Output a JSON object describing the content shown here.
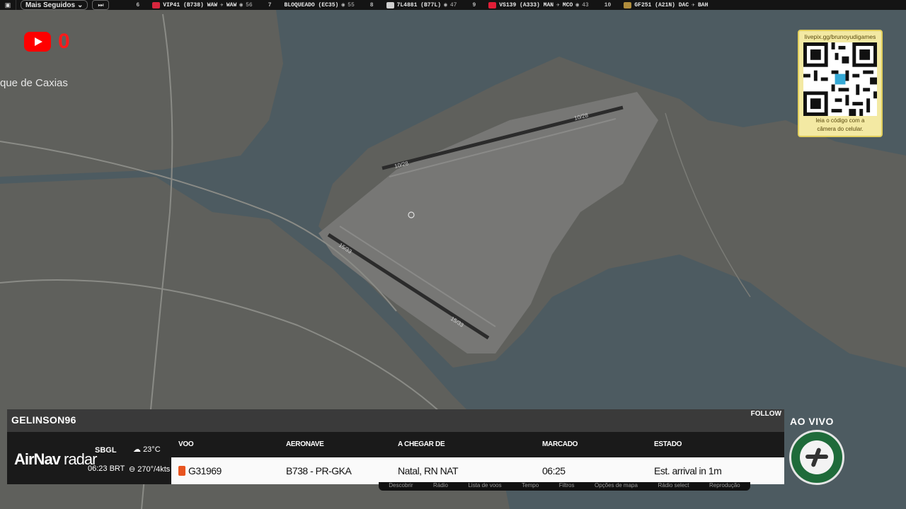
{
  "ticker": {
    "select_label": "Mais Seguidos",
    "items": [
      {
        "rank": "6",
        "flight": "VIP41 (B738) WAW",
        "dest": "WAW",
        "count": "56",
        "logo_color": "#d7263d"
      },
      {
        "rank": "7",
        "flight": "BLOQUEADO (EC35)",
        "dest": "",
        "count": "55",
        "logo_color": ""
      },
      {
        "rank": "8",
        "flight": "7L4881 (B77L)",
        "dest": "",
        "count": "47",
        "logo_color": "#cfcfcf"
      },
      {
        "rank": "9",
        "flight": "VS139 (A333) MAN",
        "dest": "MCO",
        "count": "43",
        "logo_color": "#e01e37"
      },
      {
        "rank": "10",
        "flight": "GF251 (A21N) DAC",
        "dest": "BAH",
        "count": "",
        "logo_color": "#b08d3c"
      }
    ]
  },
  "youtube": {
    "count": "0"
  },
  "map": {
    "place_label": "que de Caxias",
    "runway_labels": [
      "10/28",
      "10/28",
      "15/33",
      "15/33"
    ]
  },
  "qr": {
    "url": "livepix.gg/brunoyudigames",
    "caption_line1": "leia o código com a",
    "caption_line2": "câmera do celular."
  },
  "panel": {
    "username": "GELINSON96",
    "follow": "FOLLOW",
    "brand_bold": "AirNav",
    "brand_light": " radar",
    "airport": "SBGL",
    "local_time": "06:23 BRT",
    "temperature": "23°C",
    "wind": "270°/4kts",
    "headers": {
      "flight": "VOO",
      "aircraft": "AERONAVE",
      "arriving_from": "A CHEGAR DE",
      "scheduled": "MARCADO",
      "status": "ESTADO"
    },
    "row": {
      "flight": "G31969",
      "aircraft": "B738 - PR-GKA",
      "arriving_from": "Natal, RN NAT",
      "scheduled": "06:25",
      "status": "Est. arrival in 1m"
    },
    "subbar": [
      "Descobrir",
      "Rádio",
      "Lista de voos",
      "Tempo",
      "Filtros",
      "Opções de mapa",
      "Rádio select",
      "Reprodução"
    ]
  },
  "live": {
    "label": "AO VIVO"
  },
  "colors": {
    "water": "#4c5a60",
    "land": "#5c5d59",
    "airport": "#7b7b7b",
    "runway": "#2a2a2a"
  }
}
